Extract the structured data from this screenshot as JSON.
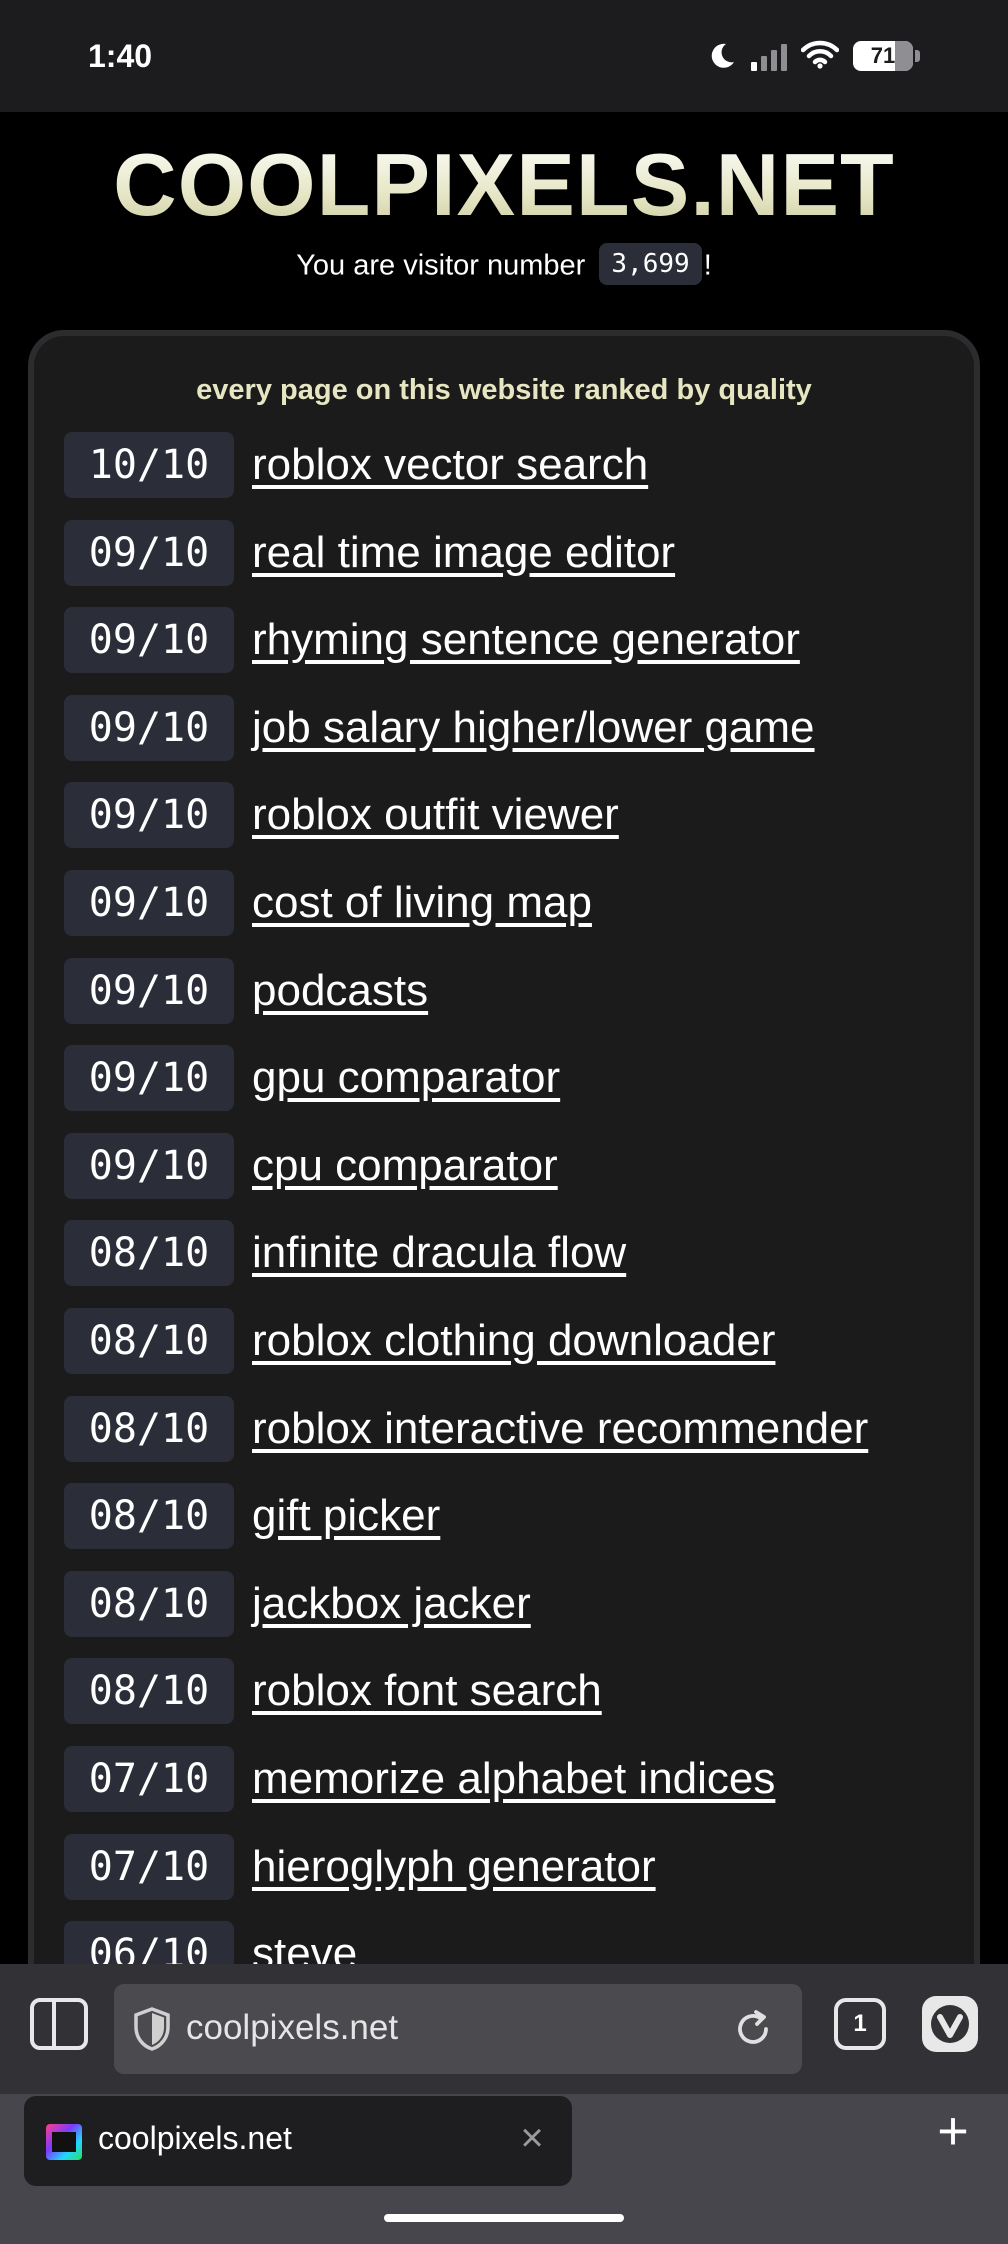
{
  "status_bar": {
    "time": "1:40",
    "battery_level": "71",
    "icons": [
      "moon-icon",
      "cellular-signal-icon",
      "wifi-icon",
      "battery-icon"
    ]
  },
  "site": {
    "title": "COOLPIXELS.NET",
    "visitor_prefix": "You are visitor number",
    "visitor_count": "3,699",
    "visitor_suffix": "!",
    "ranking_heading": "every page on this website ranked by quality",
    "pages": [
      {
        "score": "10/10",
        "name": "roblox vector search",
        "linked": true
      },
      {
        "score": "09/10",
        "name": "real time image editor",
        "linked": true
      },
      {
        "score": "09/10",
        "name": "rhyming sentence generator",
        "linked": true
      },
      {
        "score": "09/10",
        "name": "job salary higher/lower game",
        "linked": true
      },
      {
        "score": "09/10",
        "name": "roblox outfit viewer",
        "linked": true
      },
      {
        "score": "09/10",
        "name": "cost of living map",
        "linked": true
      },
      {
        "score": "09/10",
        "name": "podcasts",
        "linked": true
      },
      {
        "score": "09/10",
        "name": "gpu comparator",
        "linked": true
      },
      {
        "score": "09/10",
        "name": "cpu comparator",
        "linked": true
      },
      {
        "score": "08/10",
        "name": "infinite dracula flow",
        "linked": true
      },
      {
        "score": "08/10",
        "name": "roblox clothing downloader",
        "linked": true
      },
      {
        "score": "08/10",
        "name": "roblox interactive recommender",
        "linked": true
      },
      {
        "score": "08/10",
        "name": "gift picker",
        "linked": true
      },
      {
        "score": "08/10",
        "name": "jackbox jacker",
        "linked": true
      },
      {
        "score": "08/10",
        "name": "roblox font search",
        "linked": true
      },
      {
        "score": "07/10",
        "name": "memorize alphabet indices",
        "linked": true
      },
      {
        "score": "07/10",
        "name": "hieroglyph generator",
        "linked": true
      },
      {
        "score": "06/10",
        "name": "steve",
        "linked": false
      }
    ]
  },
  "browser": {
    "address": "coolpixels.net",
    "tab_count": "1",
    "icons": [
      "panel-toggle-icon",
      "shield-icon",
      "reload-icon",
      "vivaldi-icon",
      "close-icon",
      "plus-icon"
    ],
    "tabs": [
      {
        "title": "coolpixels.net"
      }
    ]
  }
}
